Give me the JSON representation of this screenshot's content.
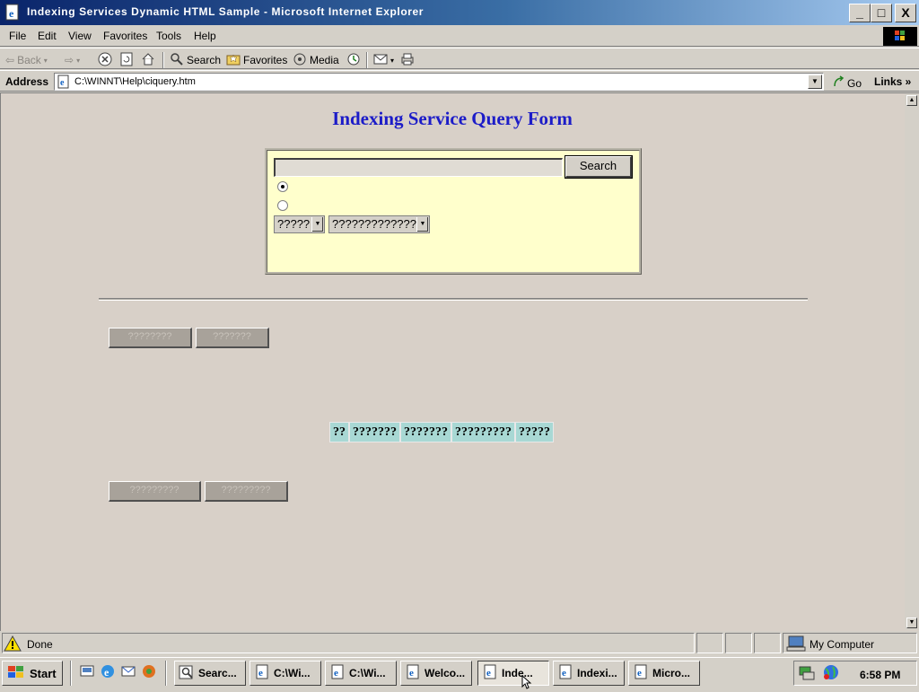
{
  "window": {
    "title": "Indexing Services Dynamic HTML Sample - Microsoft Internet Explorer",
    "controls": {
      "minimize": "_",
      "maximize": "□",
      "close": "X"
    }
  },
  "menu": {
    "items": [
      "File",
      "Edit",
      "View",
      "Favorites",
      "Tools",
      "Help"
    ]
  },
  "toolbar": {
    "back": "Back",
    "search": "Search",
    "favorites": "Favorites",
    "media": "Media"
  },
  "address": {
    "label": "Address",
    "url": "C:\\WINNT\\Help\\ciquery.htm",
    "go": "Go",
    "links": "Links"
  },
  "page": {
    "title": "Indexing Service Query Form",
    "form": {
      "query_value": "",
      "search_button": "Search",
      "radio_1_selected": true,
      "radio_2_selected": false,
      "select_1": "?????",
      "select_2": "?????????????"
    },
    "buttons_top": [
      "????????",
      "???????"
    ],
    "result_headers": [
      "??",
      "???????",
      "???????",
      "?????????",
      "?????"
    ],
    "buttons_bottom": [
      "?????????",
      "?????????"
    ]
  },
  "status": {
    "text": "Done",
    "zone": "My Computer"
  },
  "taskbar": {
    "start": "Start",
    "tasks": [
      {
        "label": "Searc...",
        "active": false
      },
      {
        "label": "C:\\Wi...",
        "active": false
      },
      {
        "label": "C:\\Wi...",
        "active": false
      },
      {
        "label": "Welco...",
        "active": false
      },
      {
        "label": "Inde...",
        "active": true
      },
      {
        "label": "Indexi...",
        "active": false
      },
      {
        "label": "Micro...",
        "active": false
      }
    ],
    "clock": "6:58 PM"
  }
}
